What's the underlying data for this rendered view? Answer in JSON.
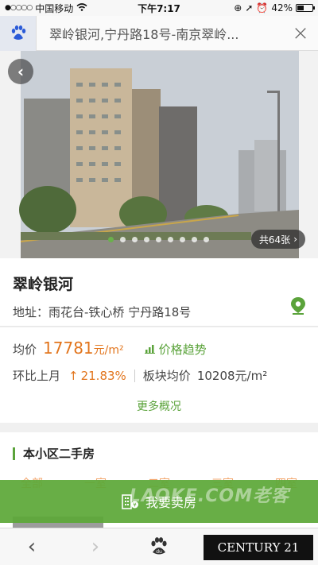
{
  "status_bar": {
    "carrier": "中国移动",
    "time": "下午7:17",
    "battery": "42%",
    "battery_level": 0.42
  },
  "header": {
    "title": "翠岭银河,宁丹路18号-南京翠岭...",
    "close_glyph": "×"
  },
  "gallery": {
    "photo_count": "共64张",
    "total_dots": 9,
    "active_dot": 0
  },
  "info": {
    "name": "翠岭银河",
    "address_label": "地址：",
    "address": "雨花台-铁心桥 宁丹路18号"
  },
  "price": {
    "avg_label": "均价",
    "avg_value": "17781",
    "avg_unit": "元/m²",
    "trend_label": "价格趋势",
    "mom_label": "环比上月",
    "mom_value": "21.83%",
    "block_avg_label": "板块均价",
    "block_avg_value": "10208元/m²",
    "more_label": "更多概况"
  },
  "secondhand": {
    "title": "本小区二手房",
    "tabs": [
      "全部",
      "一室",
      "二室",
      "三室",
      "四室"
    ]
  },
  "sell": {
    "label": "我要卖房"
  },
  "watermark": "LAOKE.COM老客",
  "bottom_nav": {
    "back": "‹",
    "forward": "›",
    "logo": "CENTURY 21"
  },
  "colors": {
    "accent_green": "#5ba33b",
    "accent_orange": "#e2751d"
  }
}
